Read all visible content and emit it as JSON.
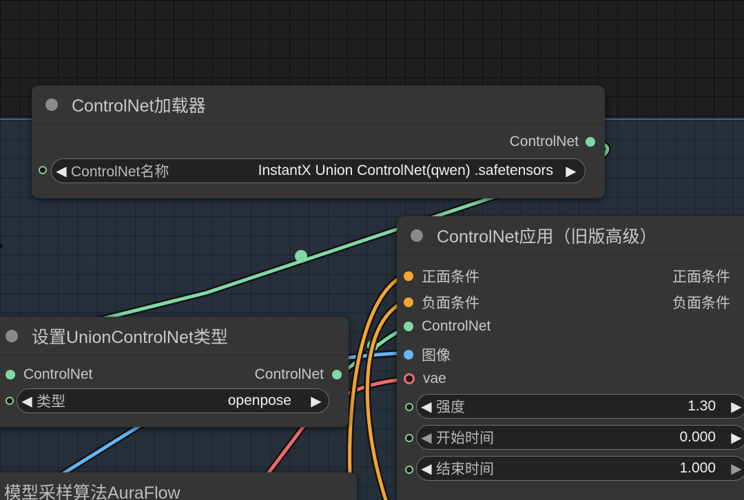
{
  "nodes": {
    "loader": {
      "title": "ControlNet加载器",
      "output": "ControlNet",
      "widget": {
        "label": "ControlNet名称",
        "value": "InstantX Union ControlNet(qwen) .safetensors"
      }
    },
    "apply": {
      "title": "ControlNet应用（旧版高级）",
      "inputs": [
        "正面条件",
        "负面条件",
        "ControlNet",
        "图像",
        "vae"
      ],
      "outputs": [
        "正面条件",
        "负面条件"
      ],
      "widgets": [
        {
          "label": "强度",
          "value": "1.30"
        },
        {
          "label": "开始时间",
          "value": "0.000"
        },
        {
          "label": "结束时间",
          "value": "1.000"
        }
      ]
    },
    "union": {
      "title": "设置UnionControlNet类型",
      "input": "ControlNet",
      "output": "ControlNet",
      "widget": {
        "label": "类型",
        "value": "openpose"
      }
    },
    "sampler": {
      "title": "模型采样算法AuraFlow"
    }
  },
  "colors": {
    "conditioning": "#f2a531",
    "controlnet": "#7fd8a6",
    "image": "#64b5f6",
    "vae": "#ef6b6b",
    "node_bg": "#353535",
    "group_bg": "#25303a"
  },
  "icons": {
    "arrow_left": "◀",
    "arrow_right": "▶"
  }
}
